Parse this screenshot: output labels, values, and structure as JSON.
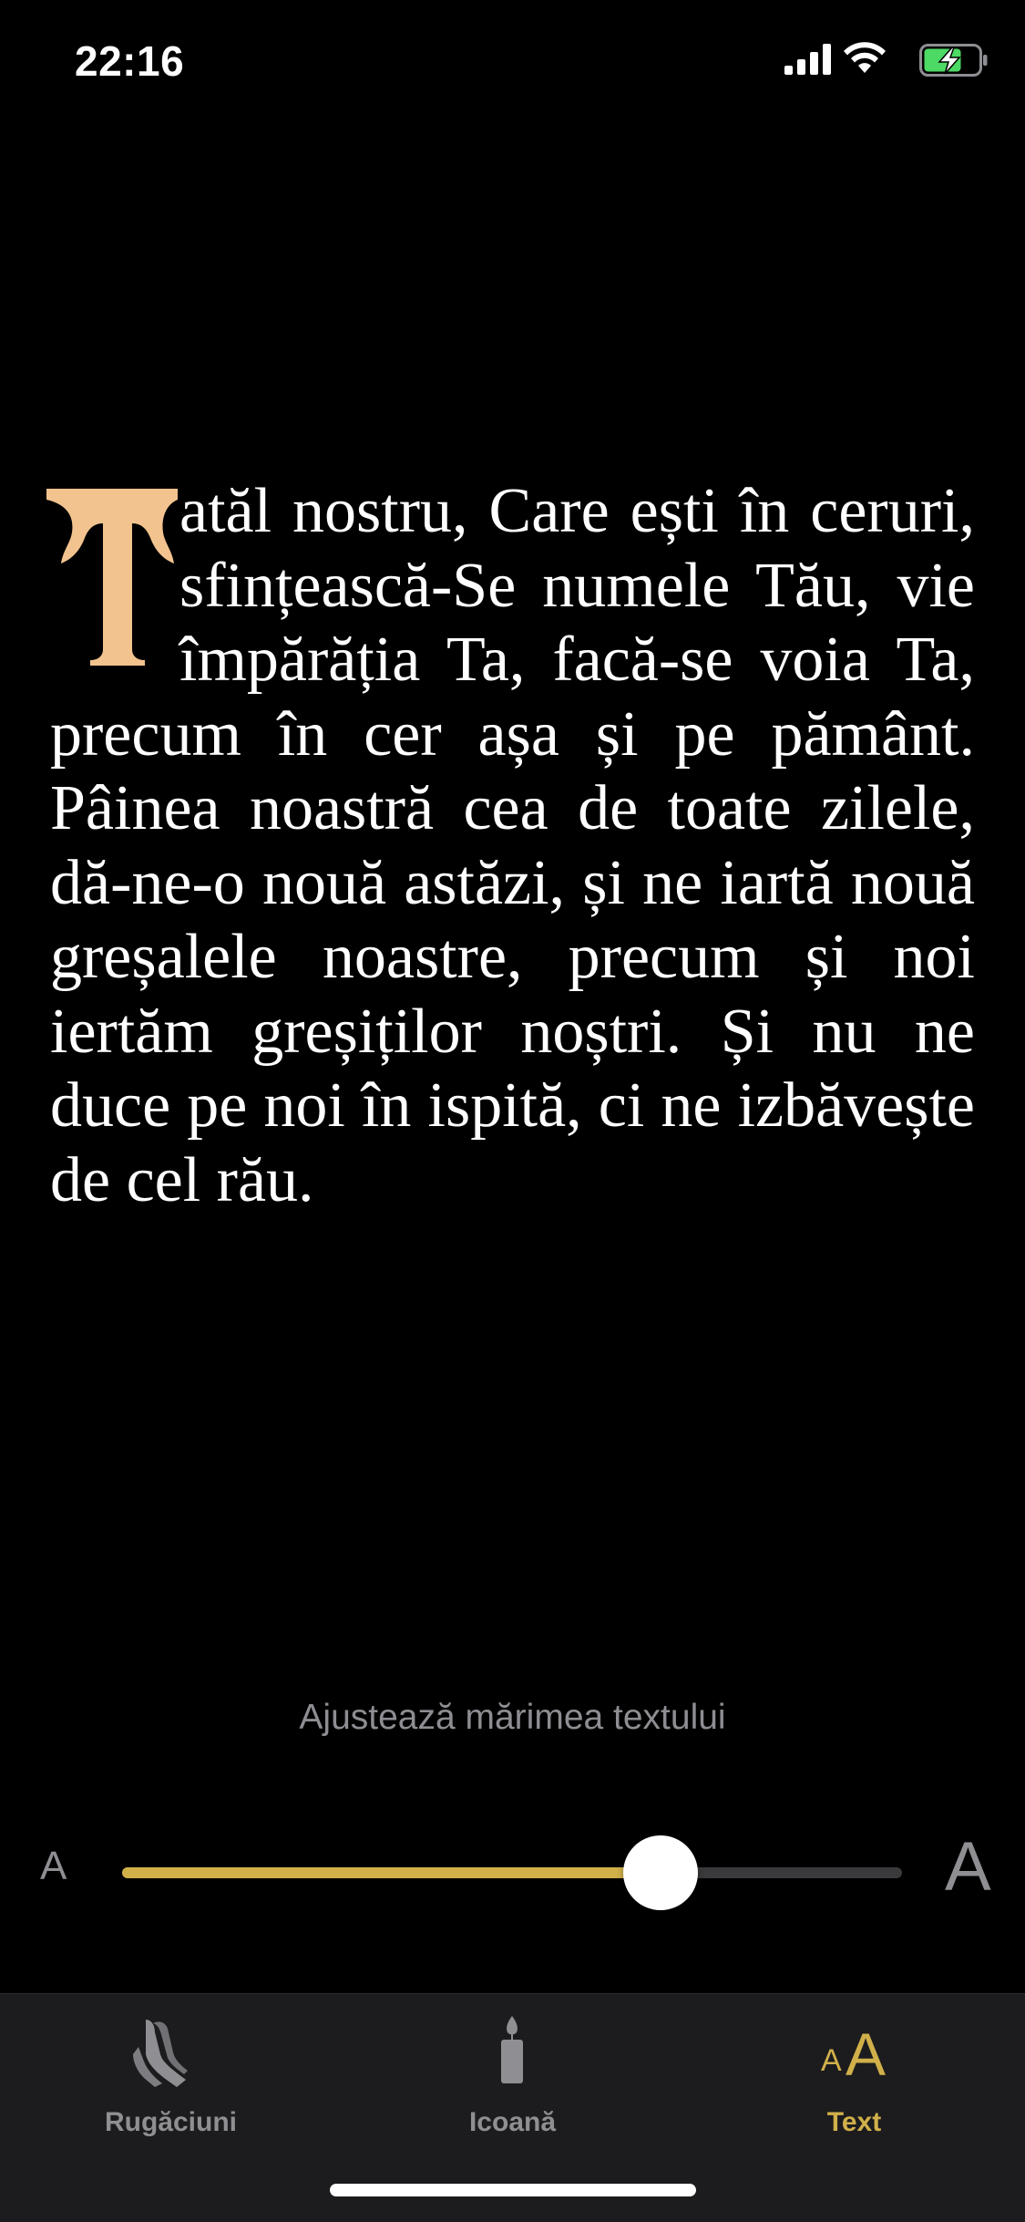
{
  "status_bar": {
    "time": "22:16"
  },
  "prayer": {
    "dropcap_letter": "T",
    "text": "atăl nostru, Care ești în ce­ruri, sfințească-Se numele Tău, vie împărăția Ta, facă-se voia Ta, precum în cer așa și pe pământ. Pâinea noastră cea de toate zilele, dă-ne-o nouă astăzi, și ne iartă nouă greșalele noastre, precum și noi iertăm greșiților noștri. Și nu ne duce pe noi în ispită, ci ne izbăvește de cel rău.",
    "dropcap_color": "#f2c38f"
  },
  "text_size": {
    "caption": "Ajustează mărimea textului",
    "small_label": "A",
    "large_label": "A",
    "value_fraction": 0.69,
    "accent_color": "#d1b04a"
  },
  "tab_bar": {
    "tabs": [
      {
        "label": "Rugăciuni",
        "icon": "praying-hands-icon",
        "active": false
      },
      {
        "label": "Icoană",
        "icon": "candle-icon",
        "active": false
      },
      {
        "label": "Text",
        "icon": "text-size-icon",
        "active": true,
        "icon_small": "A",
        "icon_large": "A"
      }
    ]
  }
}
